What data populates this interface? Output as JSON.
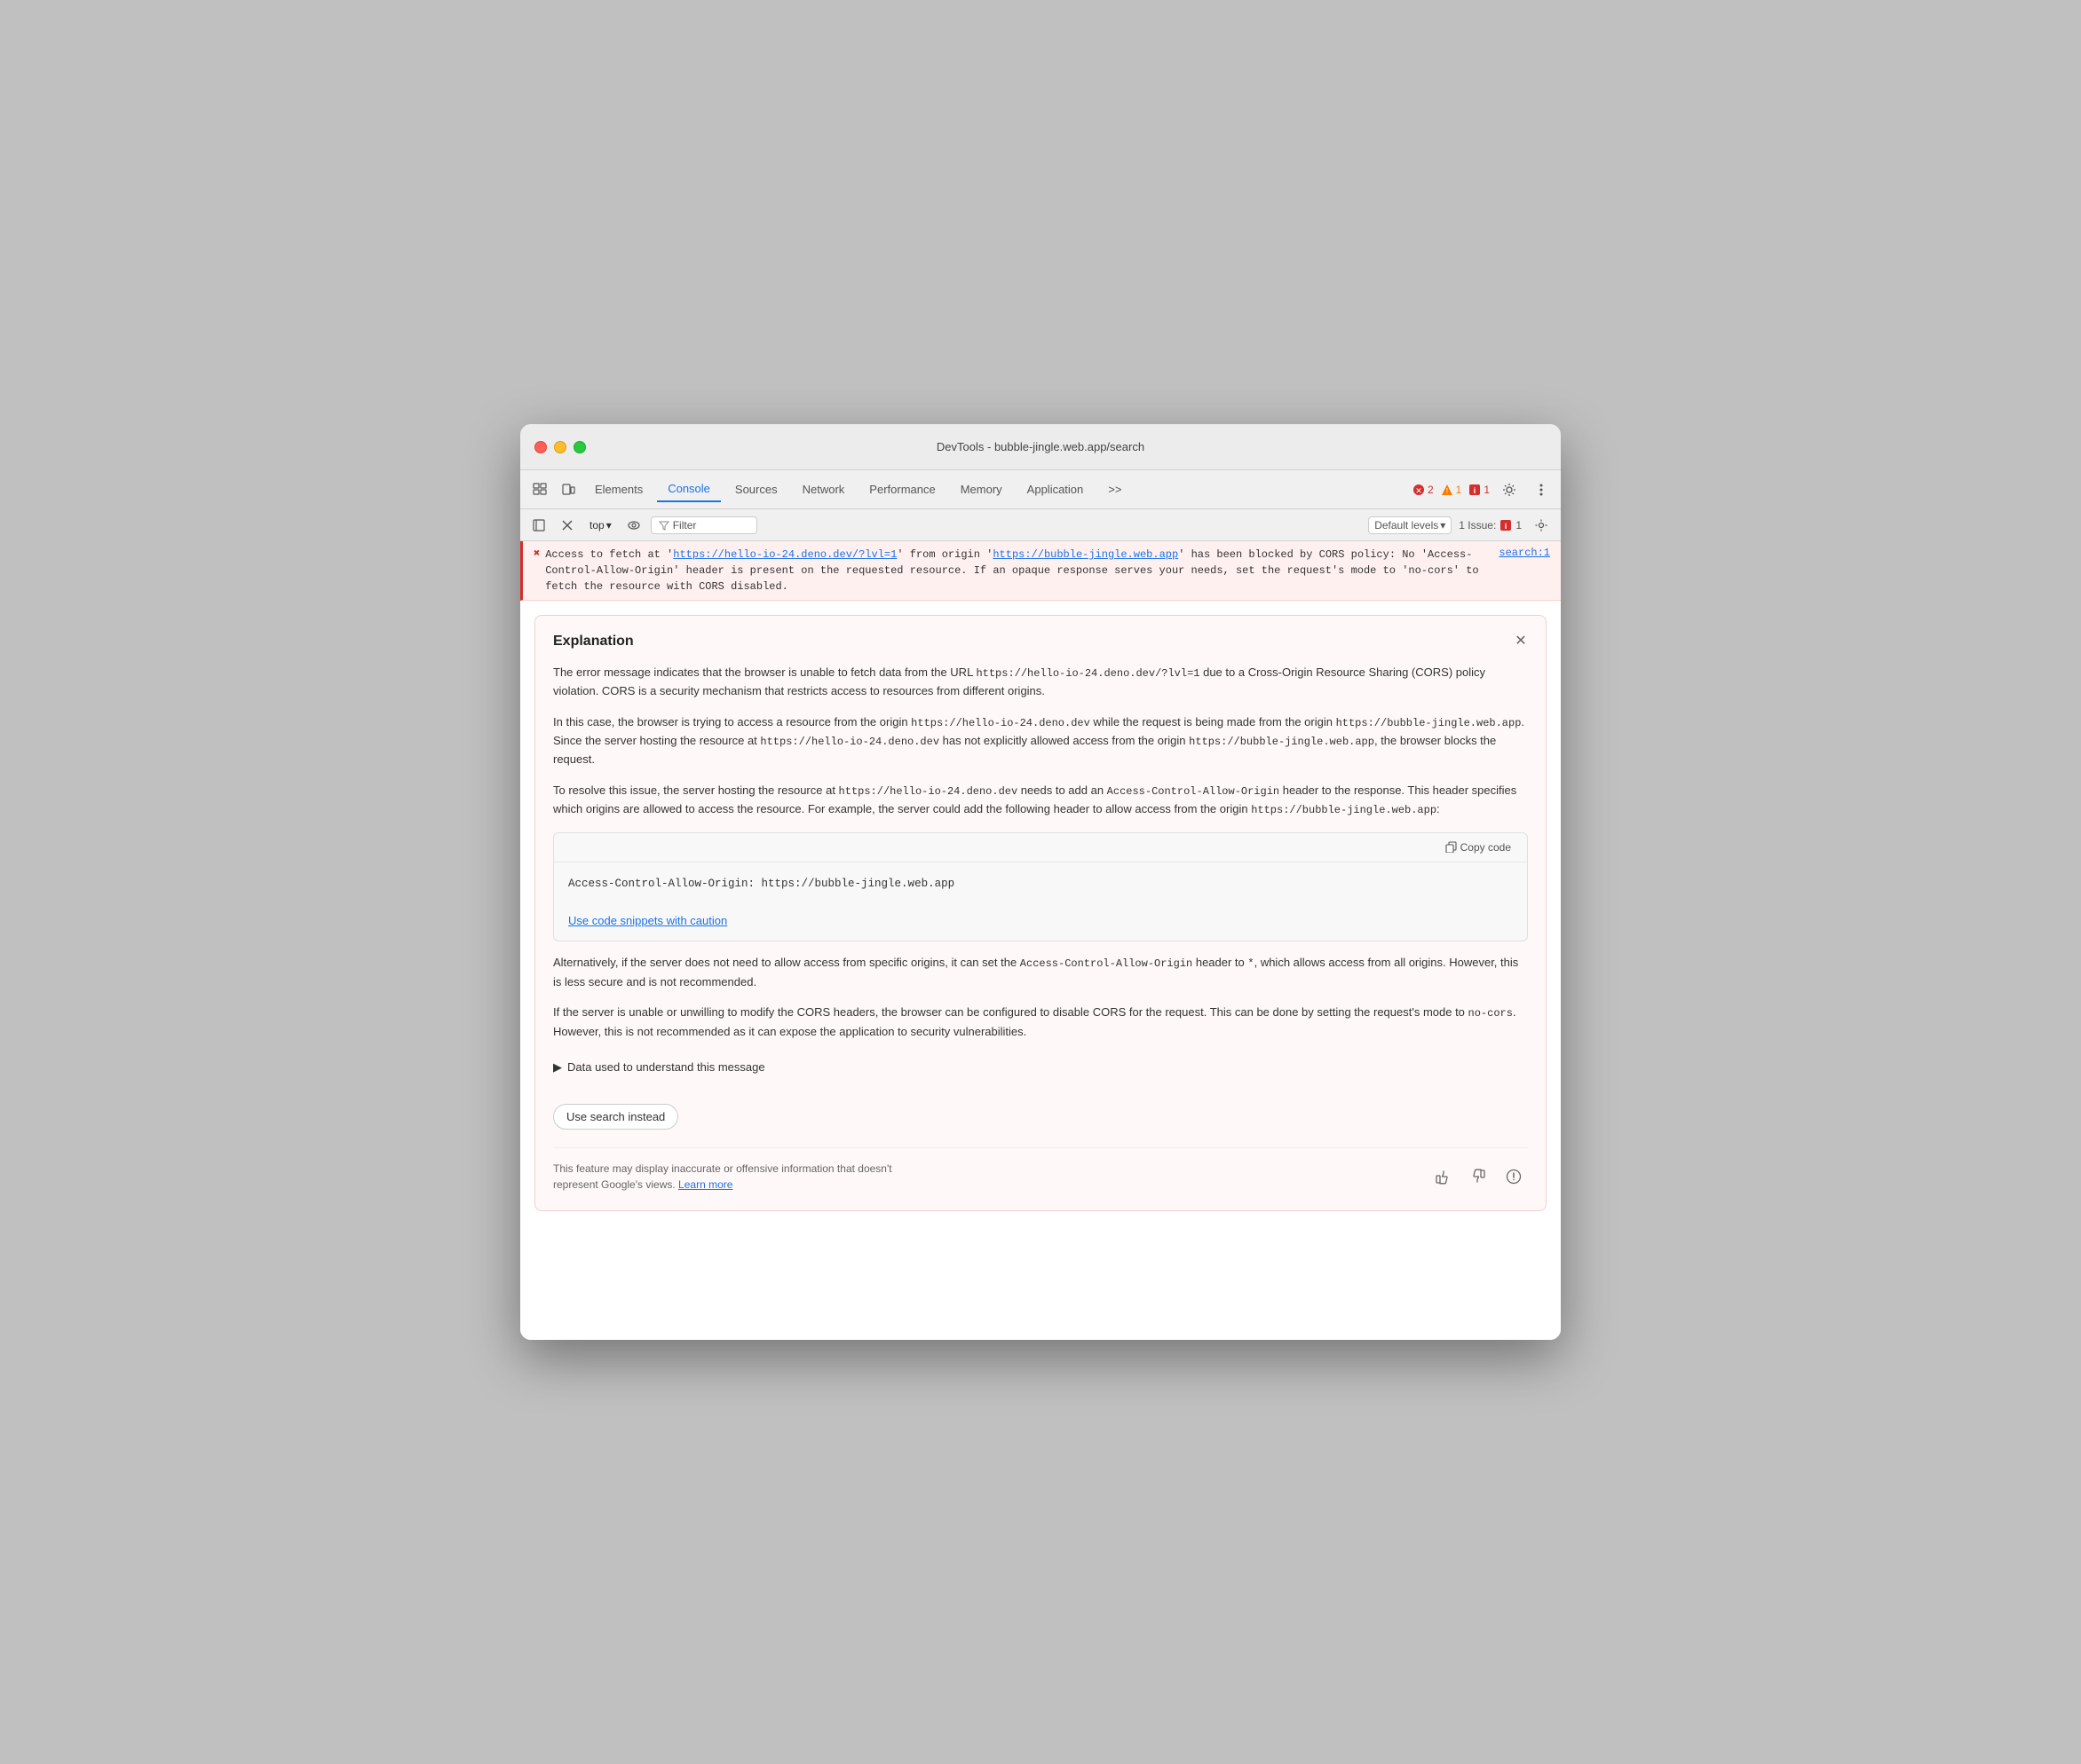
{
  "window": {
    "title": "DevTools - bubble-jingle.web.app/search"
  },
  "toolbar": {
    "tabs": [
      {
        "id": "elements",
        "label": "Elements",
        "active": false
      },
      {
        "id": "console",
        "label": "Console",
        "active": true
      },
      {
        "id": "sources",
        "label": "Sources",
        "active": false
      },
      {
        "id": "network",
        "label": "Network",
        "active": false
      },
      {
        "id": "performance",
        "label": "Performance",
        "active": false
      },
      {
        "id": "memory",
        "label": "Memory",
        "active": false
      },
      {
        "id": "application",
        "label": "Application",
        "active": false
      }
    ],
    "more_label": ">>",
    "error_count": "2",
    "warn_count": "1",
    "info_count": "1"
  },
  "secondary_toolbar": {
    "context": "top",
    "filter_placeholder": "Filter",
    "filter_label": "Filter",
    "levels_label": "Default levels",
    "issues_label": "1 Issue:",
    "issues_count": "1"
  },
  "error": {
    "icon": "✖",
    "text_part1": "Access to fetch at '",
    "link1_text": "https://hello-io-24.deno.dev/?lvl=1",
    "link1_href": "https://hello-io-24.deno.dev/?lvl=1",
    "text_part2": "' from origin '",
    "link2_text": "https://bubble-jingle.web.app",
    "link2_href": "https://bubble-jingle.web.app",
    "text_part3": "' has been blocked by CORS policy: No 'Access-Control-Allow-Origin' header is present on the requested resource. If an opaque response serves your needs, set the request's mode to 'no-cors' to fetch the resource with CORS disabled.",
    "source": "search:1"
  },
  "explanation": {
    "title": "Explanation",
    "para1": "The error message indicates that the browser is unable to fetch data from the URL ",
    "para1_code": "https://hello-io-24.deno.dev/?lvl=1",
    "para1_cont": " due to a Cross-Origin Resource Sharing (CORS) policy violation. CORS is a security mechanism that restricts access to resources from different origins.",
    "para2": "In this case, the browser is trying to access a resource from the origin ",
    "para2_code1": "https://hello-io-24.deno.dev",
    "para2_cont1": " while the request is being made from the origin ",
    "para2_code2": "https://bubble-jingle.web.app",
    "para2_cont2": ". Since the server hosting the resource at ",
    "para2_code3": "https://hello-io-24.deno.dev",
    "para2_cont3": " has not explicitly allowed access from the origin ",
    "para2_code4": "https://bubble-jingle.web.app",
    "para2_cont4": ", the browser blocks the request.",
    "para3": "To resolve this issue, the server hosting the resource at ",
    "para3_code1": "https://hello-io-24.deno.dev",
    "para3_cont1": " needs to add an ",
    "para3_code2": "Access-Control-Allow-Origin",
    "para3_cont2": " header to the response. This header specifies which origins are allowed to access the resource. For example, the server could add the following header to allow access from the origin ",
    "para3_code3": "https://bubble-jingle.web.app",
    "para3_cont3": ":",
    "code_snippet": "Access-Control-Allow-Origin: https://bubble-jingle.web.app",
    "copy_code_label": "Copy code",
    "caution_link": "Use code snippets with caution",
    "para4": "Alternatively, if the server does not need to allow access from specific origins, it can set the ",
    "para4_code1": "Access-Control-Allow-Origin",
    "para4_cont1": " header to ",
    "para4_code2": "*",
    "para4_cont2": ", which allows access from all origins. However, this is less secure and is not recommended.",
    "para5": "If the server is unable or unwilling to modify the CORS headers, the browser can be configured to disable CORS for the request. This can be done by setting the request's mode to ",
    "para5_code1": "no-cors",
    "para5_cont1": ". However, this is not recommended as it can expose the application to security vulnerabilities.",
    "data_used_label": "Data used to understand this message",
    "use_search_label": "Use search instead",
    "footer_text": "This feature may display inaccurate or offensive information that doesn't represent Google's views.",
    "learn_more_label": "Learn more"
  }
}
